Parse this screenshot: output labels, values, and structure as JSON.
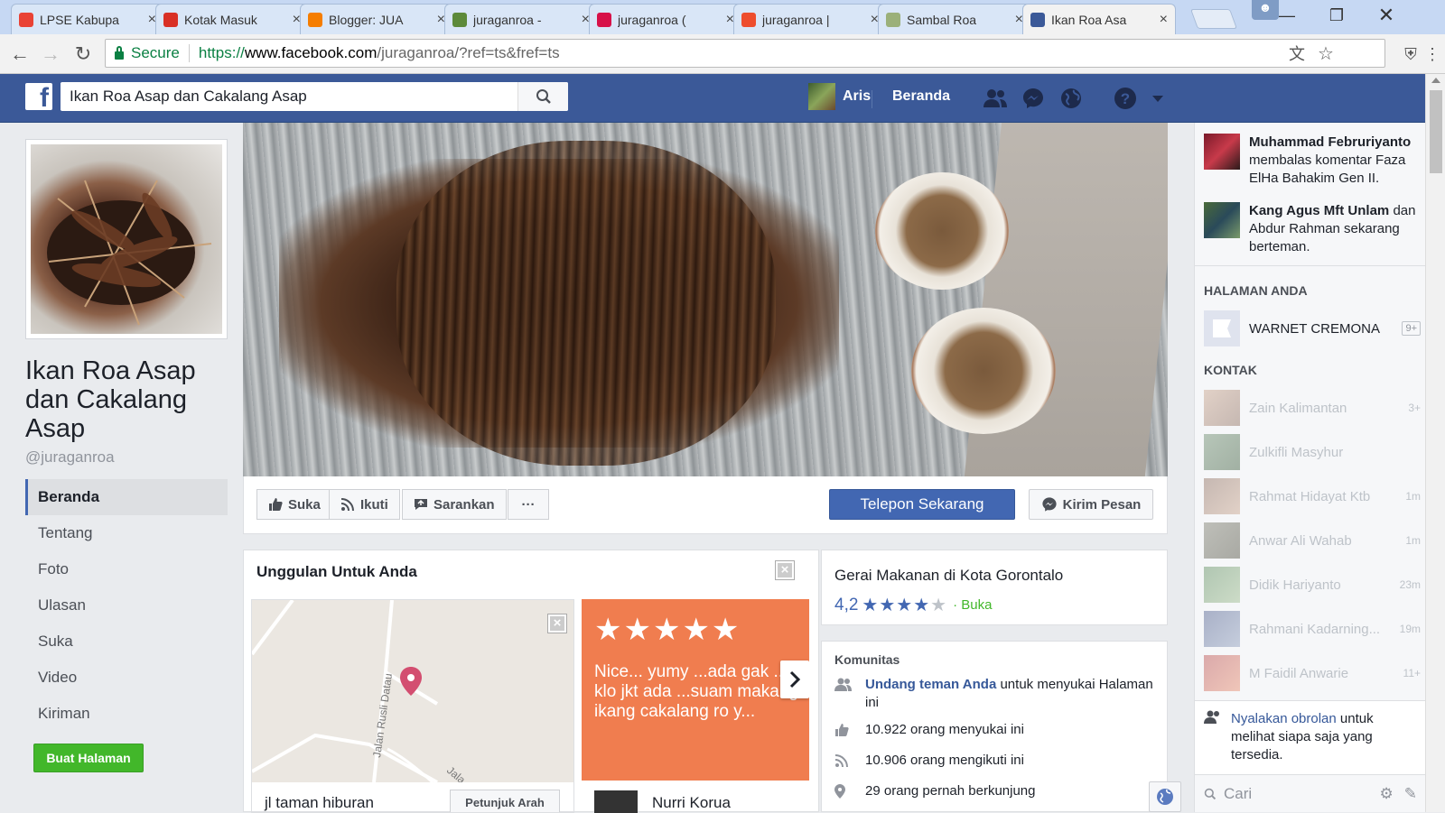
{
  "browser": {
    "tabs": [
      {
        "label": "LPSE Kabupa",
        "icon": "lpse-icon",
        "color": "#e94235"
      },
      {
        "label": "Kotak Masuk",
        "icon": "gmail-icon",
        "color": "#d93025"
      },
      {
        "label": "Blogger: JUA",
        "icon": "blogger-icon",
        "color": "#f57d00"
      },
      {
        "label": "juraganroa -",
        "icon": "android-icon",
        "color": "#5d8a3a"
      },
      {
        "label": "juraganroa (",
        "icon": "bukalapak-icon",
        "color": "#d71149"
      },
      {
        "label": "juraganroa |",
        "icon": "shopee-icon",
        "color": "#ee4d2d"
      },
      {
        "label": "Sambal Roa",
        "icon": "image-icon",
        "color": "#9bb07a"
      },
      {
        "label": "Ikan Roa Asa",
        "icon": "facebook-icon",
        "color": "#3b5998",
        "active": true
      }
    ],
    "secure_label": "Secure",
    "url_scheme": "https://",
    "url_host": "www.facebook.com",
    "url_path": "/juraganroa/?ref=ts&fref=ts"
  },
  "fb": {
    "search_value": "Ikan Roa Asap dan Cakalang Asap",
    "user_name": "Aris",
    "home_label": "Beranda"
  },
  "page": {
    "name": "Ikan Roa Asap dan Cakalang Asap",
    "username": "@juraganroa",
    "nav": [
      "Beranda",
      "Tentang",
      "Foto",
      "Ulasan",
      "Suka",
      "Video",
      "Kiriman"
    ],
    "create_page_label": "Buat Halaman"
  },
  "actions": {
    "like": "Suka",
    "follow": "Ikuti",
    "suggest": "Sarankan",
    "more": "···",
    "call": "Telepon Sekarang",
    "message": "Kirim Pesan"
  },
  "featured": {
    "title": "Unggulan Untuk Anda",
    "address": "jl taman hiburan",
    "directions": "Petunjuk Arah",
    "map_road1": "Jalan Rusli Datau",
    "map_road2": "Jala",
    "review_stars": "★★★★★",
    "review_text": "Nice... yumy ...ada gak ...cb klo jkt ada ...suam makang ikang cakalang ro y...",
    "reviewer": "Nurri Korua"
  },
  "info": {
    "category": "Gerai Makanan di Kota Gorontalo",
    "rating": "4,2",
    "rating_value": 4.2,
    "open_status": "· Buka",
    "community_heading": "Komunitas",
    "invite_link": "Undang teman Anda",
    "invite_rest": " untuk menyukai Halaman ini",
    "likes": "10.922 orang menyukai ini",
    "follows": "10.906 orang mengikuti ini",
    "visits": "29 orang pernah berkunjung"
  },
  "sidebar": {
    "notifications": [
      {
        "name": "Muhammad Februriyanto",
        "text": " membalas komentar Faza ElHa Bahakim Gen II."
      },
      {
        "name": "Kang Agus Mft Unlam",
        "text": " dan Abdur Rahman sekarang berteman."
      }
    ],
    "pages_heading": "HALAMAN ANDA",
    "page_item": "WARNET CREMONA",
    "page_badge": "9+",
    "contacts_heading": "KONTAK",
    "contacts": [
      {
        "name": "Zain Kalimantan",
        "time": "3+"
      },
      {
        "name": "Zulkifli Masyhur",
        "time": ""
      },
      {
        "name": "Rahmat Hidayat Ktb",
        "time": "1m"
      },
      {
        "name": "Anwar Ali Wahab",
        "time": "1m"
      },
      {
        "name": "Didik Hariyanto",
        "time": "23m"
      },
      {
        "name": "Rahmani Kadarning...",
        "time": "19m"
      },
      {
        "name": "M Faidil Anwarie",
        "time": "11+"
      }
    ],
    "chat_link": "Nyalakan obrolan",
    "chat_rest": " untuk melihat siapa saja yang tersedia.",
    "chat_search": "Cari"
  }
}
